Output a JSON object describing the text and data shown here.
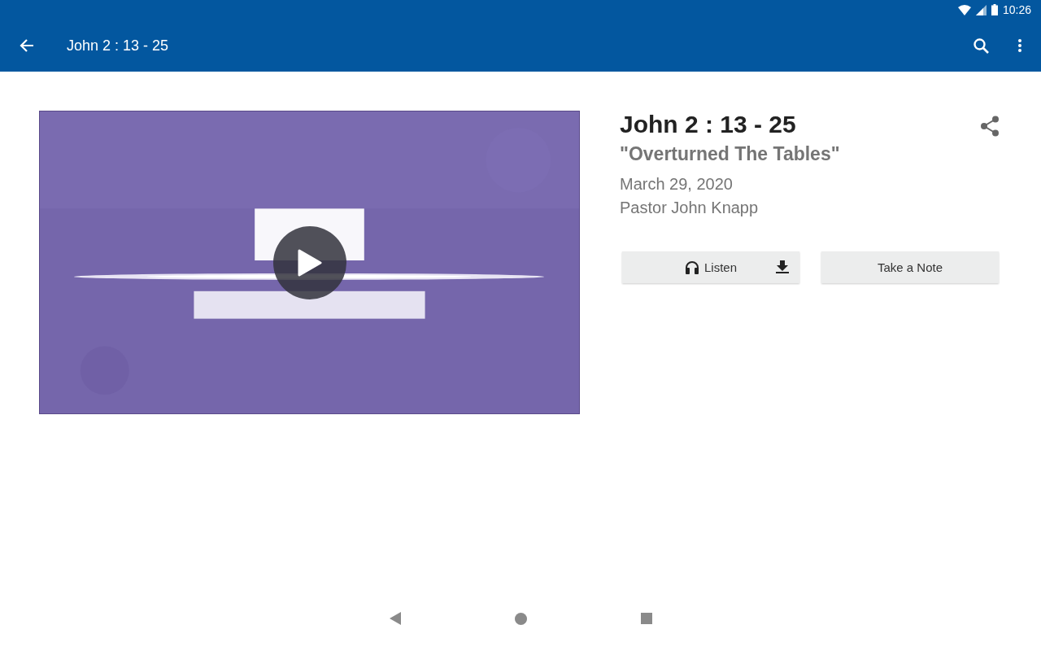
{
  "status_bar": {
    "time": "10:26"
  },
  "app_bar": {
    "title": "John 2 : 13 - 25"
  },
  "sermon": {
    "title": "John 2 : 13 - 25",
    "subtitle": "\"Overturned The Tables\"",
    "date": "March 29, 2020",
    "speaker": "Pastor John Knapp"
  },
  "buttons": [
    {
      "kind": "listen",
      "label": "Listen"
    },
    {
      "kind": "note",
      "label": "Take a Note"
    }
  ]
}
